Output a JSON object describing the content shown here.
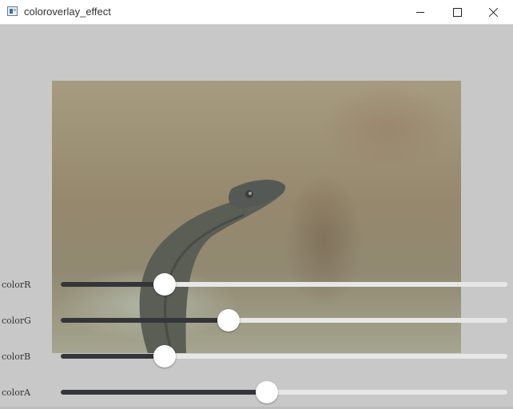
{
  "window": {
    "title": "coloroverlay_effect",
    "controls": {
      "minimize": "minimize-icon",
      "maximize": "maximize-icon",
      "close": "close-icon"
    }
  },
  "image": {
    "subject": "cobra",
    "overlay_color": "#a0a096"
  },
  "sliders": [
    {
      "label": "colorR",
      "value": 0.233
    },
    {
      "label": "colorG",
      "value": 0.376
    },
    {
      "label": "colorB",
      "value": 0.233
    },
    {
      "label": "colorA",
      "value": 0.461
    }
  ],
  "colors": {
    "background": "#c8c8c8",
    "slider_fill": "#333539",
    "slider_track": "#e7e7e7"
  }
}
